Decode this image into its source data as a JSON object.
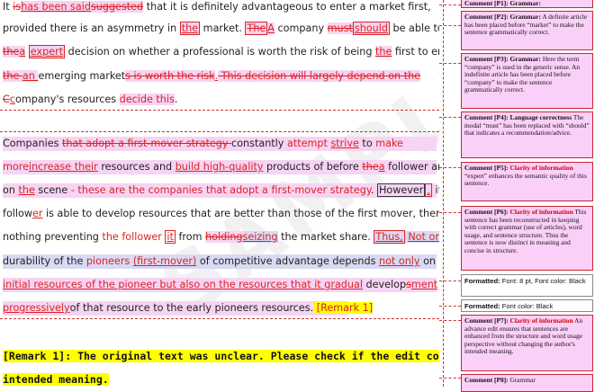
{
  "watermark": "SAMPLE",
  "para1": {
    "l1": {
      "a": "It ",
      "b": "is",
      "c": "has been said",
      "d": "suggested",
      "e": " that it is definitely advantageous to enter a market first,"
    },
    "l2": {
      "a": "provided there is an asymmetry in ",
      "b": "the",
      "c": " market. ",
      "d": "The",
      "e": "A",
      "f": " company ",
      "g": "must",
      "h": "should",
      "i": " be able to make"
    },
    "l3": {
      "a": "the",
      "b": "a",
      "c": " ",
      "d": "expert",
      "e": " decision on whether a professional is worth the risk of being ",
      "f": "the",
      "g": " first to enter"
    },
    "l4": {
      "a": "the ",
      "b": "an ",
      "c": "emerging market",
      "d": "s is worth the risk",
      "e": ".",
      "f": " This decision will largely depend on the"
    },
    "l5": {
      "a": "C",
      "b": "c",
      "c": "ompany's resources ",
      "d": "decide this",
      "e": "."
    }
  },
  "para2": {
    "l1": {
      "a": "Companies ",
      "b": "that adopt a first-mover strategy ",
      "c": "constantly ",
      "d": "attempt ",
      "e": "strive",
      "f": " to ",
      "g": "make"
    },
    "l2": {
      "a": "more",
      "b": "increase their",
      "c": " resources and ",
      "d": "build high-quality",
      "e": " products of before ",
      "f": "the",
      "g": "a",
      "h": " follower arrives"
    },
    "l3": {
      "a": "on ",
      "b": "the",
      "c": " scene",
      "d": " - these are the companies that adopt a first-mover strategy",
      "e": ". ",
      "f": "However",
      "g": ",",
      "h": " if the"
    },
    "l4": {
      "a": "follow",
      "b": "er",
      "c": " is able to develop resources that are better than those of the first mover, there is"
    },
    "l5": {
      "a": "nothing preventing ",
      "b": "the follower ",
      "c": "it",
      "d": " from ",
      "e": "holding",
      "f": "seizing",
      "g": " the market share. ",
      "h": "Thus,",
      "i": " ",
      "j": "Not only",
      "k": " the"
    },
    "l6": {
      "a": "durability of the ",
      "b": "pioneers",
      "c": " ",
      "d": "(first-mover)",
      "e": " of competitive advantage depends ",
      "f": "not only",
      "g": " on the"
    },
    "l7": {
      "a": "initial resources of the pioneer but also on the resources that it gradual",
      "b": " develop",
      "c": "s",
      "d": "ment"
    },
    "l8": {
      "a": "progressively",
      "b": "of that resource to the early pioneers resources",
      "c": ".",
      "d": " [Remark 1]"
    }
  },
  "remark": {
    "line1": "[Remark 1]: The original text was unclear. Please check if the edit conveys the",
    "line2": "intended meaning."
  },
  "comments": {
    "c1": {
      "text": "Comment [P1]: Grammar:"
    },
    "c2": {
      "head": "Comment [P2]: Grammar:",
      "body": " A definite article has been placed before “market” to make the sentence grammatically correct."
    },
    "c3": {
      "head": "Comment [P3]: Grammar:",
      "body": " Here the term “company” is used in the generic sense. An indefinite article has been placed before “company” to make the sentence grammatically correct."
    },
    "c4": {
      "head": "Comment [P4]: Language correctness",
      "body": " The modal “must” has been replaced with “should” that indicates a recommendation/advice."
    },
    "c5": {
      "head": "Comment [P5]: ",
      "cat": "Clarity of information",
      "body": " “expert” enhances the semantic quality of this sentence."
    },
    "c6": {
      "head": "Comment [P6]: ",
      "cat": "Clarity of information",
      "body": " This sentence has been reconstructed in keeping with correct grammar (use of articles), word usage, and sentence structure. Thus the sentence is now distinct in meaning and concise in structure."
    },
    "f1": {
      "head": "Formatted:",
      "body": " Font: 8 pt, Font color: Black"
    },
    "f2": {
      "head": "Formatted:",
      "body": " Font color: Black"
    },
    "c7": {
      "head": "Comment [P7]: ",
      "cat": "Clarity of information",
      "body": " An advance edit ensures that sentences are enhanced from the structure and word usage perspective without changing the author's intended meaning."
    },
    "c8": {
      "head": "Comment [P8]:",
      "body": " Grammar"
    }
  }
}
